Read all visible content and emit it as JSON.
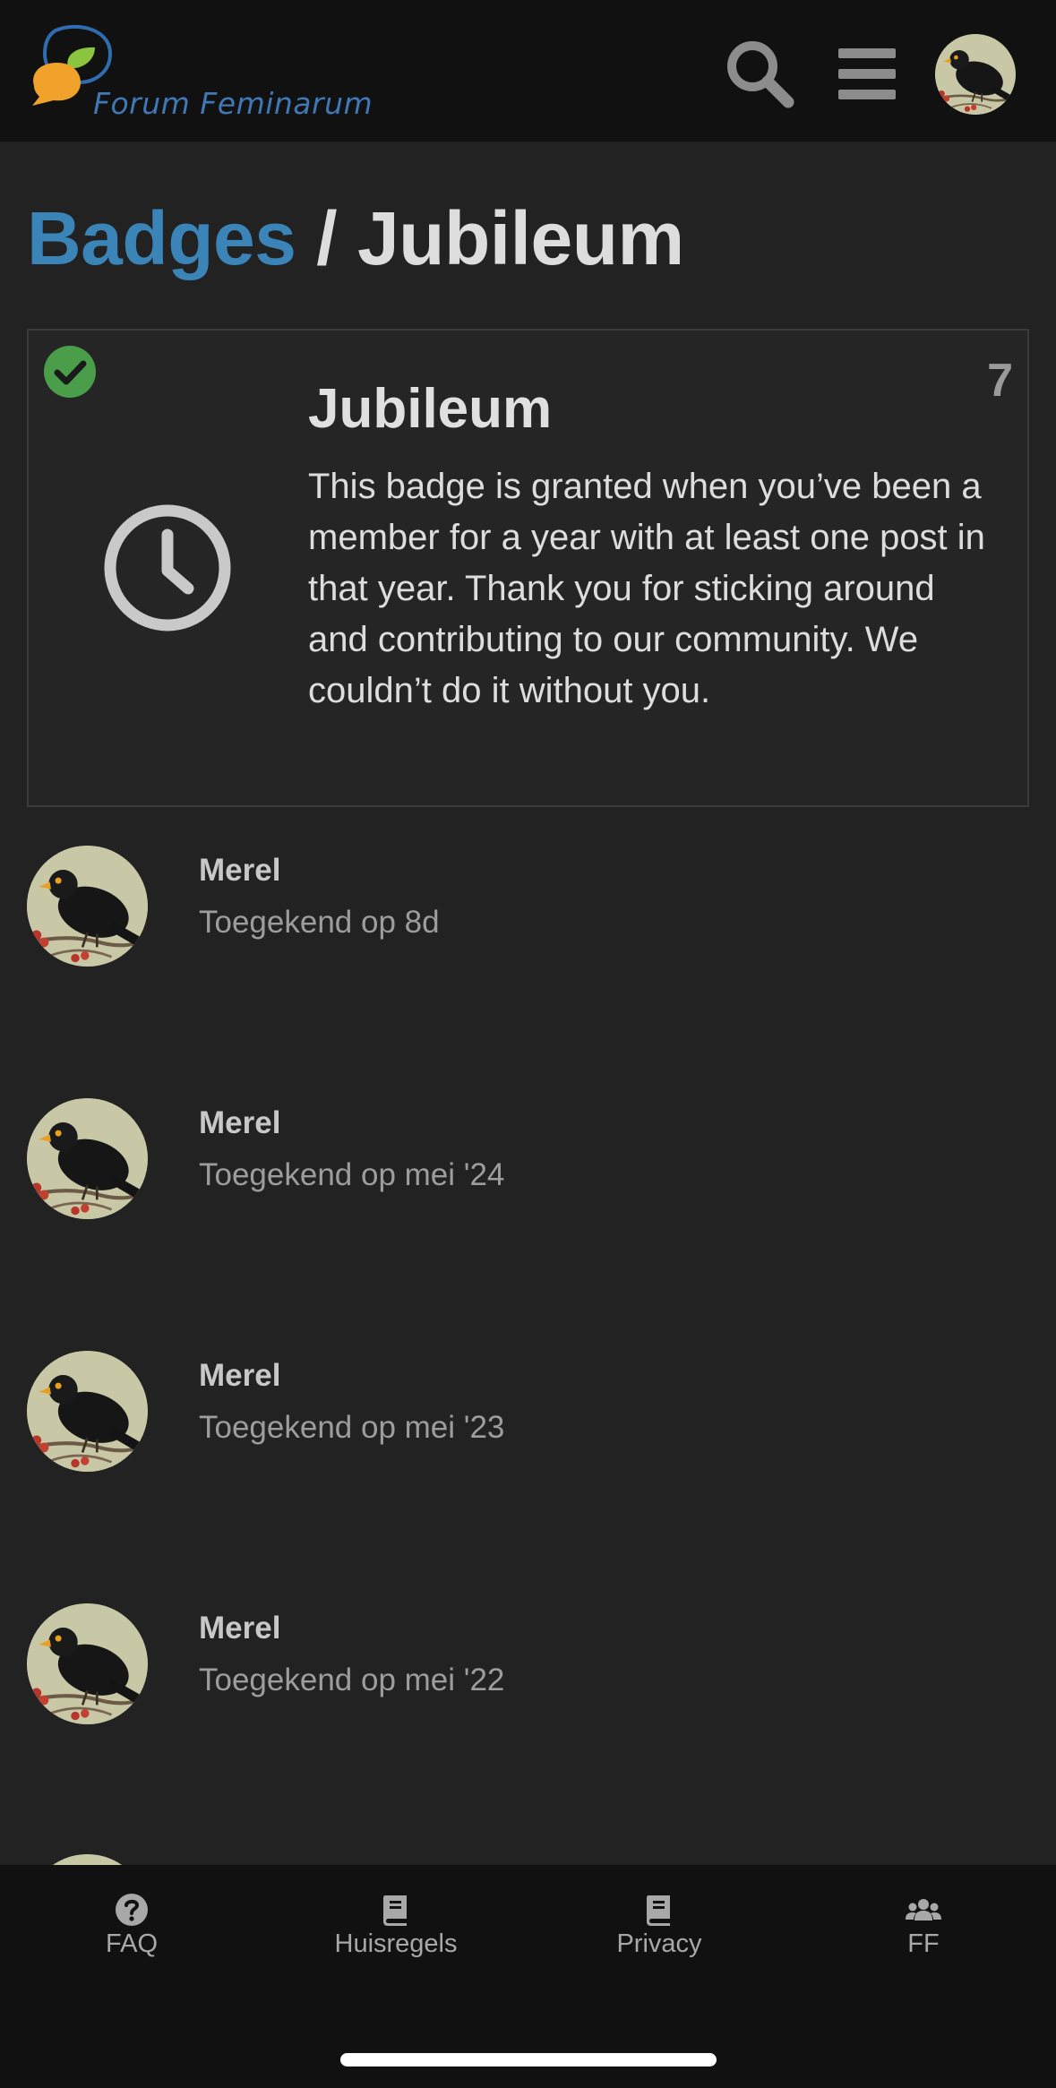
{
  "site": {
    "name": "Forum Feminarum"
  },
  "header": {
    "search_icon": "search-icon",
    "menu_icon": "hamburger-menu-icon",
    "avatar_alt": "user avatar"
  },
  "breadcrumb": {
    "parent": "Badges",
    "separator": "/",
    "current": "Jubileum"
  },
  "badge": {
    "name": "Jubileum",
    "grant_count": "7",
    "description": "This badge is granted when you’ve been a member for a year with at least one post in that year. Thank you for sticking around and contributing to our community. We couldn’t do it without you.",
    "icon": "clock-icon",
    "granted_icon": "check-circle-icon"
  },
  "grants": [
    {
      "username": "Merel",
      "date": "Toegekend op 8d"
    },
    {
      "username": "Merel",
      "date": "Toegekend op mei '24"
    },
    {
      "username": "Merel",
      "date": "Toegekend op mei '23"
    },
    {
      "username": "Merel",
      "date": "Toegekend op mei '22"
    }
  ],
  "footer": {
    "items": [
      {
        "label": "FAQ",
        "icon": "question-circle-icon"
      },
      {
        "label": "Huisregels",
        "icon": "book-icon"
      },
      {
        "label": "Privacy",
        "icon": "book-icon"
      },
      {
        "label": "FF",
        "icon": "users-icon"
      }
    ]
  },
  "colors": {
    "accent": "#3b84b8",
    "success": "#4a9e4a",
    "background": "#222222",
    "header_bg": "#111111"
  }
}
